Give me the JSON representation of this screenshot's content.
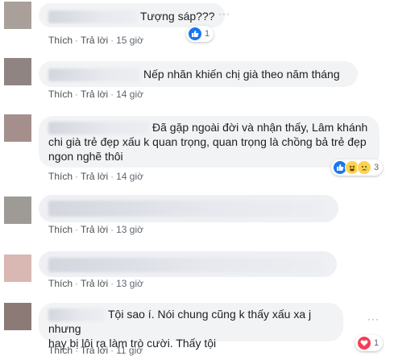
{
  "actions": {
    "like": "Thích",
    "reply": "Trả lời",
    "dot": "·",
    "more": "···"
  },
  "comments": [
    {
      "text": "Tượng sáp???",
      "time": "15 giờ",
      "reaction_count": "1",
      "reactions": [
        "like"
      ]
    },
    {
      "text": "Nếp nhăn khiến chị già theo năm tháng",
      "time": "14 giờ"
    },
    {
      "text_line1": "Đã gặp ngoài đời và nhận thấy, Lâm khánh",
      "text_line2": "chi già trẻ đẹp xấu k quan trọng, quan trọng là chồng bả trẻ đẹp",
      "text_line3": "ngon nghẽ thôi",
      "time": "14 giờ",
      "reaction_count": "3",
      "reactions": [
        "like",
        "haha",
        "sad"
      ]
    },
    {
      "text": "",
      "time": "13 giờ"
    },
    {
      "text": "",
      "time": "13 giờ"
    },
    {
      "text_line1": "Tội sao í. Nói chung cũng k thấy xấu xa j nhưng",
      "text_line2": "hay bị lôi ra làm trò cười. Thấy tội",
      "time": "11 giờ",
      "reaction_count": "1",
      "reactions": [
        "love"
      ]
    }
  ]
}
